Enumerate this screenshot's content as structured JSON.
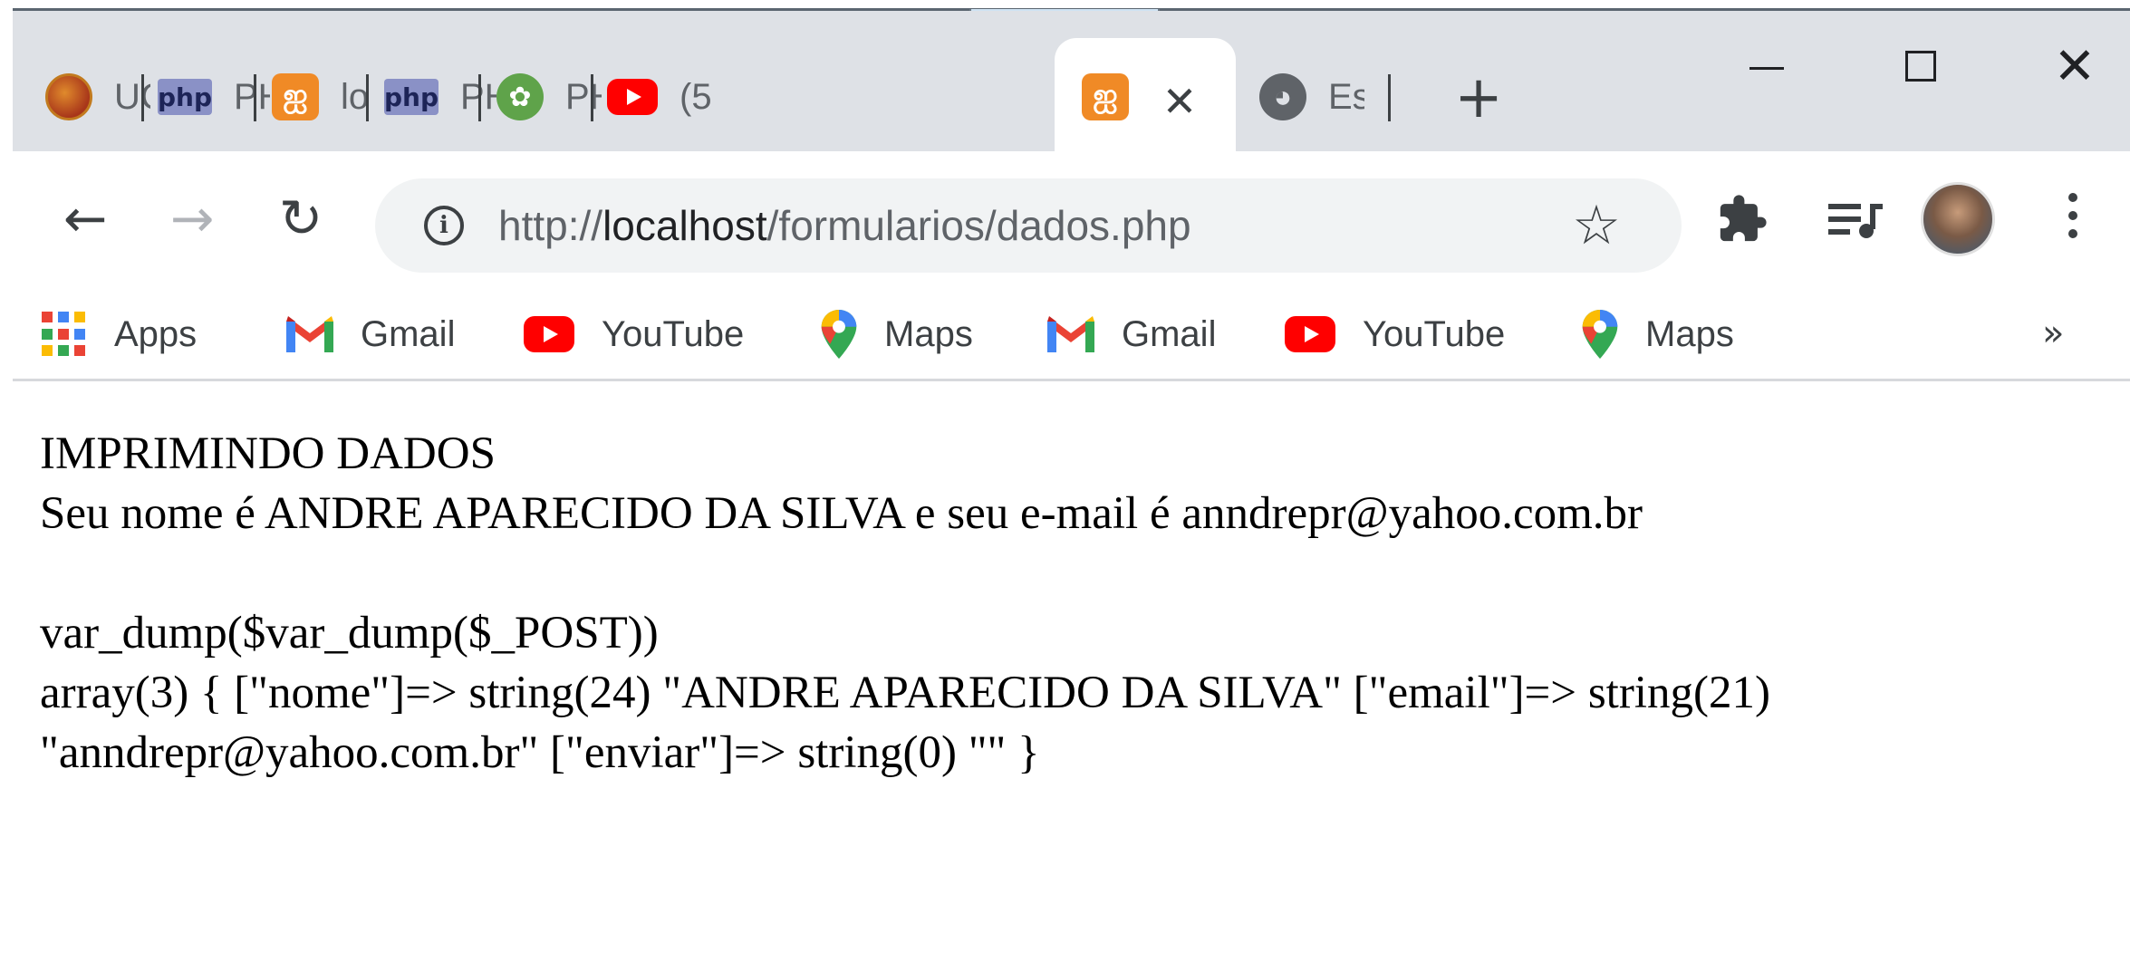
{
  "tabs": [
    {
      "title": "UC",
      "favicon": "ubuntu-icon",
      "active": false
    },
    {
      "title": "PH",
      "favicon": "php-icon",
      "active": false
    },
    {
      "title": "lo",
      "favicon": "xampp-icon",
      "active": false
    },
    {
      "title": "PH",
      "favicon": "php-icon",
      "active": false
    },
    {
      "title": "PH",
      "favicon": "recycle-icon",
      "active": false
    },
    {
      "title": "(5",
      "favicon": "youtube-icon",
      "active": false
    },
    {
      "title": "",
      "favicon": "xampp-icon",
      "active": true
    },
    {
      "title": "Es",
      "favicon": "globe-icon",
      "active": false
    }
  ],
  "fav_text": {
    "php": "php",
    "xampp": "ஐ",
    "recycle": "✿",
    "globe": "◕"
  },
  "controls": {
    "close_tab": "✕",
    "new_tab": "+",
    "close_window": "✕"
  },
  "nav": {
    "back": "←",
    "forward": "→",
    "reload": "↻"
  },
  "address_bar": {
    "info": "i",
    "url_prefix": "http://",
    "url_host": "localhost",
    "url_path": "/formularios/dados.php",
    "star": "☆"
  },
  "bookmarks": [
    {
      "label": "Apps",
      "icon": "apps-grid-icon"
    },
    {
      "label": "Gmail",
      "icon": "gmail-icon"
    },
    {
      "label": "YouTube",
      "icon": "youtube-icon"
    },
    {
      "label": "Maps",
      "icon": "maps-pin-icon"
    },
    {
      "label": "Gmail",
      "icon": "gmail-icon"
    },
    {
      "label": "YouTube",
      "icon": "youtube-icon"
    },
    {
      "label": "Maps",
      "icon": "maps-pin-icon"
    }
  ],
  "bookmarks_overflow": "»",
  "content": {
    "heading": "IMPRIMINDO DADOS",
    "message": "Seu nome é ANDRE APARECIDO DA SILVA e seu e-mail é anndrepr@yahoo.com.br",
    "dump_call": "var_dump($var_dump($_POST))",
    "dump_line1": "array(3) { [\"nome\"]=> string(24) \"ANDRE APARECIDO DA SILVA\" [\"email\"]=> string(21)",
    "dump_line2": "\"anndrepr@yahoo.com.br\" [\"enviar\"]=> string(0) \"\" }"
  },
  "colors": {
    "tabstrip_bg": "#dee1e6",
    "omnibox_bg": "#f1f3f4",
    "youtube_red": "#ff0000",
    "xampp_orange": "#f08a26"
  }
}
